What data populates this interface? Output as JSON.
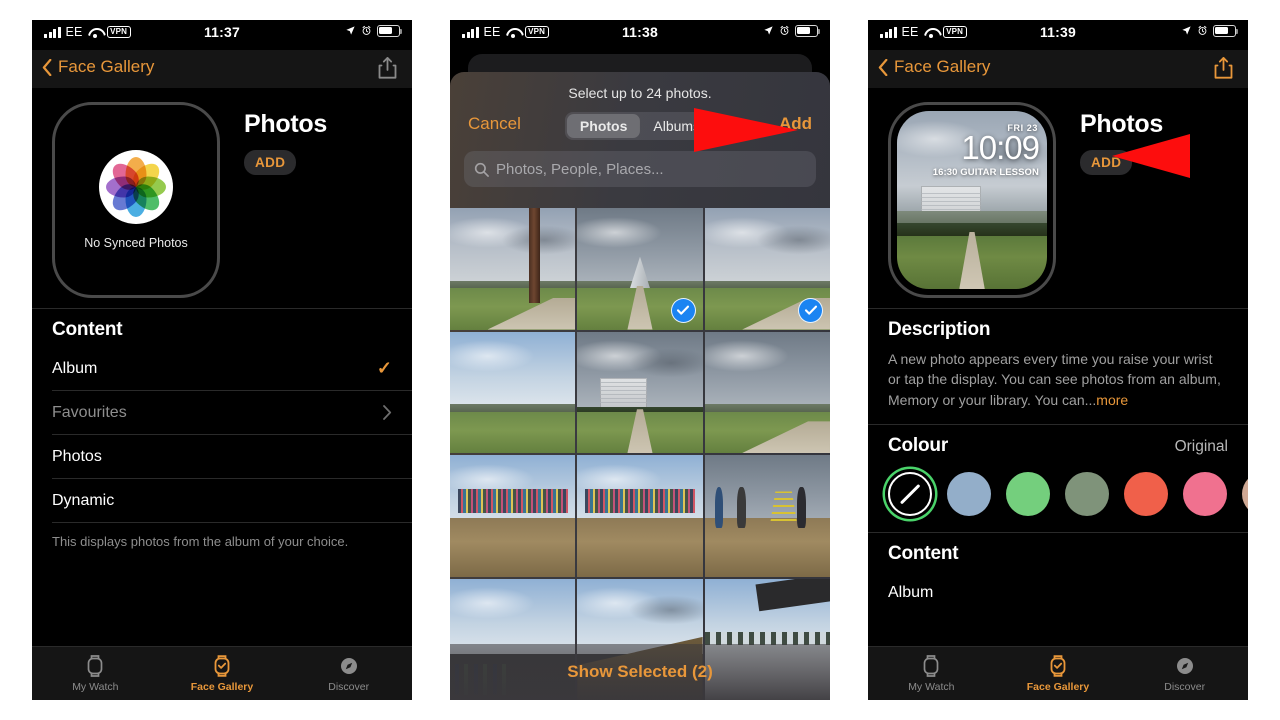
{
  "panels": {
    "p1": {
      "status": {
        "carrier": "EE",
        "vpn": "VPN",
        "time": "11:37"
      },
      "nav": {
        "back": "Face Gallery"
      },
      "face": {
        "title": "Photos",
        "add": "ADD",
        "empty": "No Synced Photos"
      },
      "content": {
        "title": "Content",
        "rows": [
          {
            "label": "Album",
            "accessory": "tick"
          },
          {
            "label": "Favourites",
            "accessory": "chevron"
          },
          {
            "label": "Photos",
            "accessory": "none"
          },
          {
            "label": "Dynamic",
            "accessory": "none"
          }
        ],
        "note": "This displays photos from the album of your choice."
      },
      "tabs": [
        {
          "label": "My Watch",
          "active": false
        },
        {
          "label": "Face Gallery",
          "active": true
        },
        {
          "label": "Discover",
          "active": false
        }
      ]
    },
    "p2": {
      "status": {
        "carrier": "EE",
        "vpn": "VPN",
        "time": "11:38"
      },
      "sheet": {
        "note": "Select up to 24 photos.",
        "cancel": "Cancel",
        "add": "Add",
        "segments": [
          {
            "label": "Photos",
            "selected": true
          },
          {
            "label": "Albums",
            "selected": false
          }
        ],
        "search_placeholder": "Photos, People, Places...",
        "show_selected": "Show Selected (2)",
        "selected_count": 2,
        "photos": [
          {
            "art": "totem",
            "selected": false
          },
          {
            "art": "monument",
            "selected": true
          },
          {
            "art": "field",
            "selected": true
          },
          {
            "art": "valley",
            "selected": false
          },
          {
            "art": "tower",
            "selected": false
          },
          {
            "art": "path",
            "selected": false
          },
          {
            "art": "crowd",
            "selected": false
          },
          {
            "art": "crowd2",
            "selected": false
          },
          {
            "art": "ladder",
            "selected": false
          },
          {
            "art": "group",
            "selected": false
          },
          {
            "art": "hill",
            "selected": false
          },
          {
            "art": "snow",
            "selected": false
          }
        ]
      }
    },
    "p3": {
      "status": {
        "carrier": "EE",
        "vpn": "VPN",
        "time": "11:39"
      },
      "nav": {
        "back": "Face Gallery"
      },
      "face": {
        "title": "Photos",
        "add": "ADD",
        "watch": {
          "date": "FRI 23",
          "time": "10:09",
          "event": "16:30 GUITAR LESSON"
        }
      },
      "description": {
        "title": "Description",
        "body": "A new photo appears every time you raise your wrist or tap the display. You can see photos from an album, Memory or your library. You can...",
        "more": "more"
      },
      "colour": {
        "title": "Colour",
        "value": "Original",
        "swatches": [
          {
            "name": "none",
            "hex": "#000000",
            "selected": true
          },
          {
            "name": "blue-grey",
            "hex": "#93aec9",
            "selected": false
          },
          {
            "name": "green",
            "hex": "#74cf7d",
            "selected": false
          },
          {
            "name": "sage",
            "hex": "#7f937a",
            "selected": false
          },
          {
            "name": "red",
            "hex": "#f0604a",
            "selected": false
          },
          {
            "name": "pink",
            "hex": "#f0718f",
            "selected": false
          },
          {
            "name": "tan",
            "hex": "#cfa894",
            "selected": false
          }
        ]
      },
      "content": {
        "title": "Content",
        "rows": [
          {
            "label": "Album"
          }
        ]
      },
      "tabs": [
        {
          "label": "My Watch",
          "active": false
        },
        {
          "label": "Face Gallery",
          "active": true
        },
        {
          "label": "Discover",
          "active": false
        }
      ]
    }
  },
  "annotations": {
    "arrow_add_sheet": "red-arrow-pointing-right-at-add",
    "arrow_add_button": "red-arrow-pointing-left-at-add"
  }
}
